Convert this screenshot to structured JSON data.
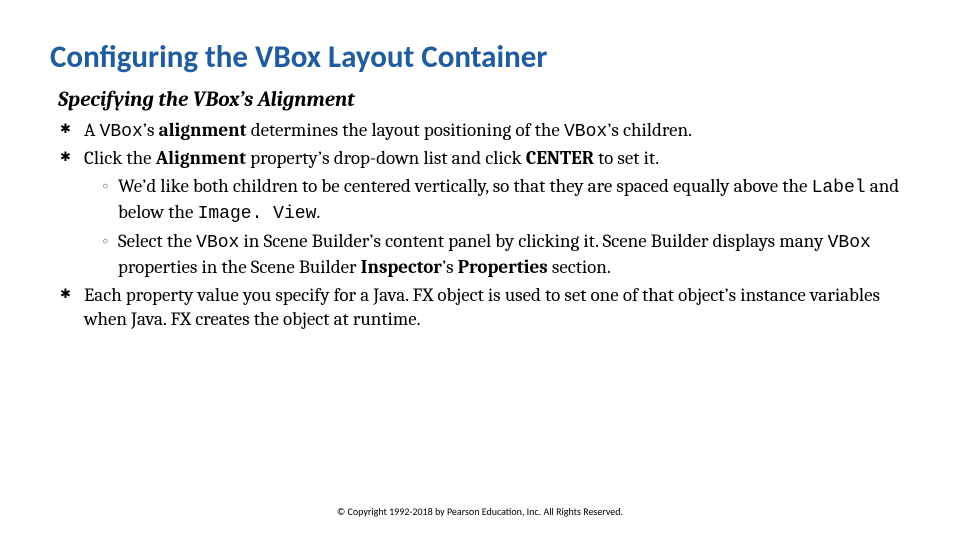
{
  "title": "Configuring the VBox Layout Container",
  "subtitle": "Specifying the VBox’s Alignment",
  "b1": {
    "pre": "A ",
    "code1": "VBox",
    "mid1": "’s ",
    "bold1": "alignment",
    "mid2": " determines the layout positioning of the ",
    "code2": "VBox",
    "post": "’s children."
  },
  "b2": {
    "pre": "Click the ",
    "bold1": "Alignment",
    "mid": " property’s drop-down list and click ",
    "bold2": "CENTER",
    "post": " to set it."
  },
  "s1": {
    "pre": "We’d like both children to be centered vertically, so that they are spaced equally above the ",
    "code1": "Label",
    "mid": " and below the ",
    "code2": "Image. View",
    "post": "."
  },
  "s2": {
    "pre": "Select the ",
    "code1": "VBox",
    "mid1": " in Scene Builder’s content panel by clicking it. Scene Builder displays many ",
    "code2": "VBox",
    "mid2": " properties in the Scene Builder ",
    "bold1": "Inspector",
    "mid3": "’s ",
    "bold2": "Properties",
    "post": " section."
  },
  "b3": "Each property value you specify for a Java. FX object is used to set one of that object’s instance variables when Java. FX creates the object at runtime.",
  "footer": "© Copyright 1992-2018 by Pearson Education, Inc. All Rights Reserved."
}
